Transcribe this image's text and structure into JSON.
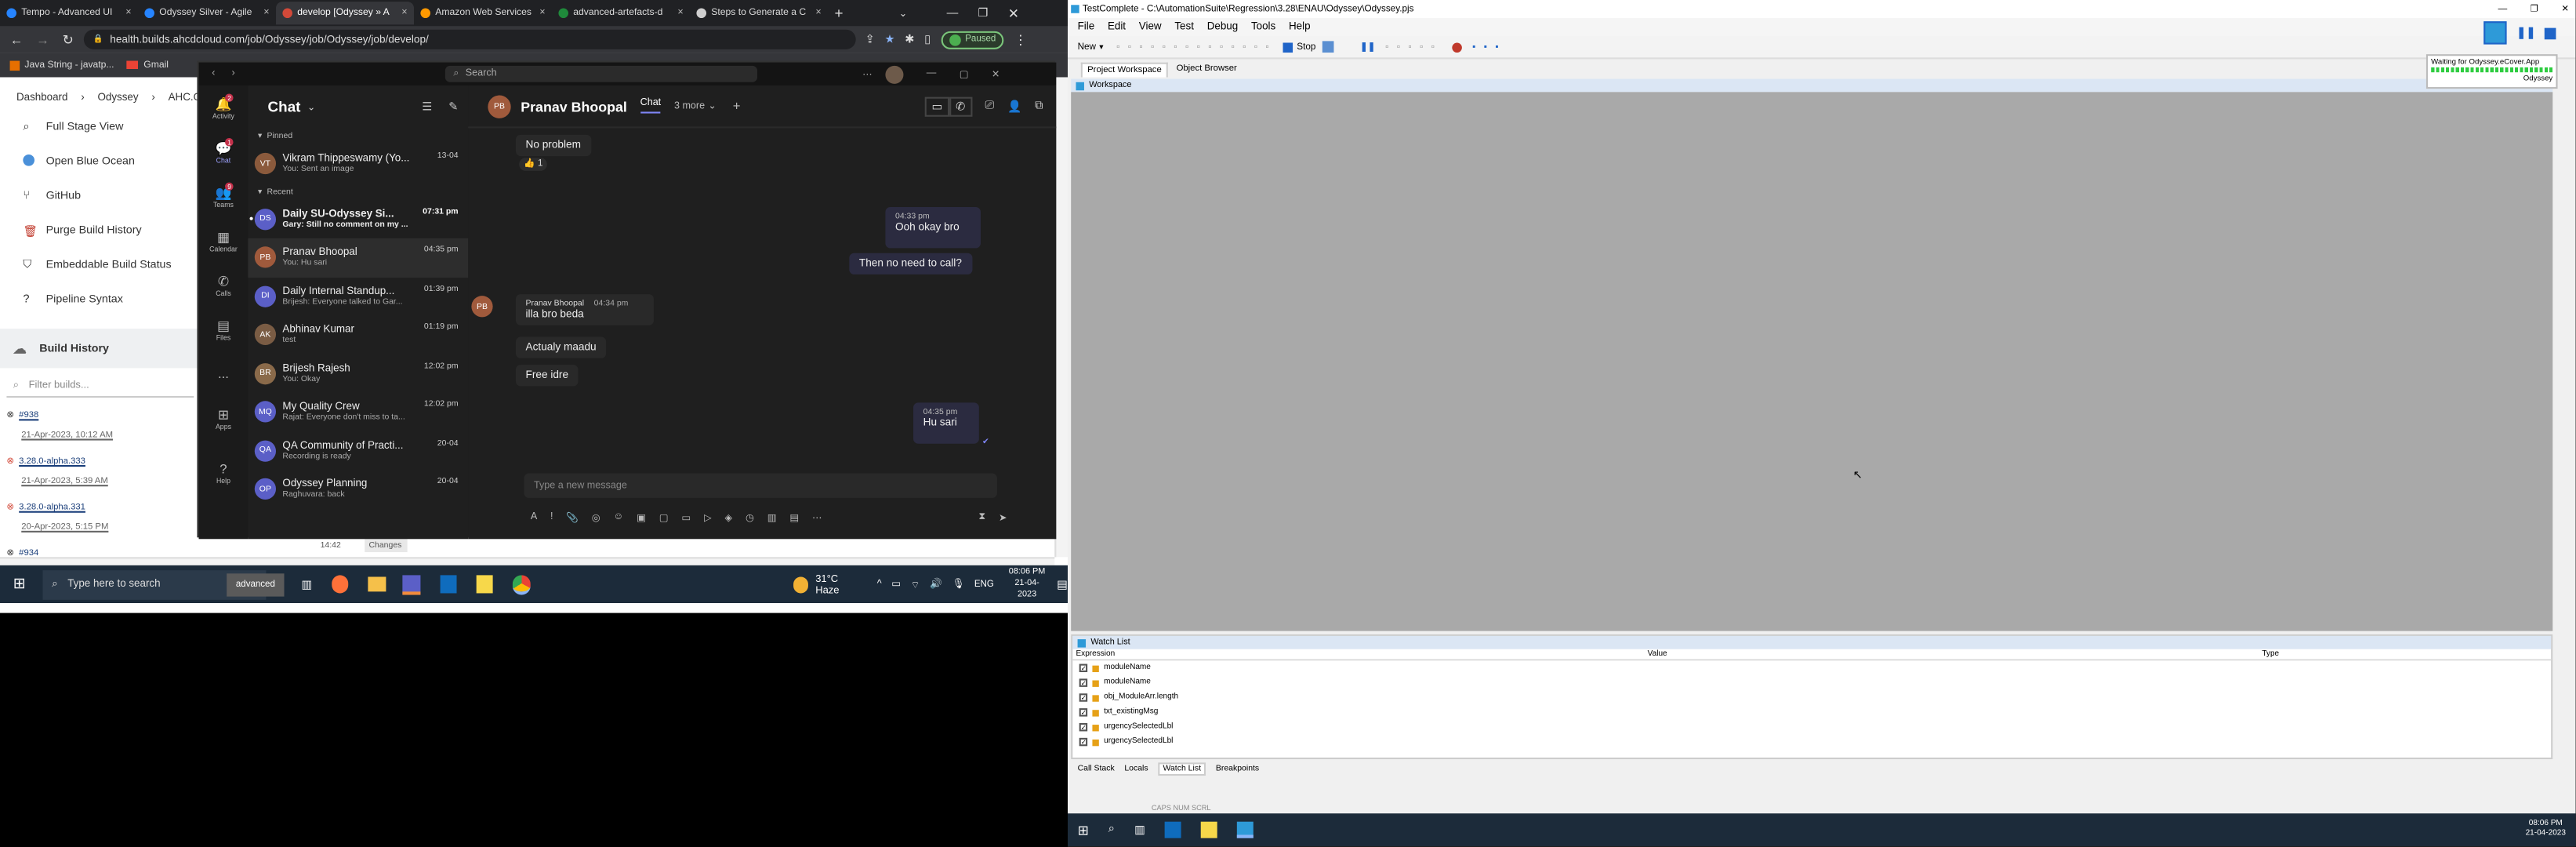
{
  "browser": {
    "tabs": [
      {
        "title": "Tempo - Advanced UI",
        "color": "#2684ff"
      },
      {
        "title": "Odyssey Silver - Agile",
        "color": "#2684ff"
      },
      {
        "title": "develop [Odyssey » A",
        "color": "#d24939"
      },
      {
        "title": "Amazon Web Services",
        "color": "#ff9900"
      },
      {
        "title": "advanced-artefacts-d",
        "color": "#1f8a3b"
      },
      {
        "title": "Steps to Generate a C",
        "color": "#cfcfcf"
      }
    ],
    "url": "health.builds.ahcdcloud.com/job/Odyssey/job/Odyssey/job/develop/",
    "profile_status": "Paused",
    "bookmarks": [
      "Java String - javatp...",
      "Gmail"
    ]
  },
  "jenkins": {
    "breadcrumbs": [
      "Dashboard",
      "Odyssey",
      "AHC.Od"
    ],
    "menu": [
      "Full Stage View",
      "Open Blue Ocean",
      "GitHub",
      "Purge Build History",
      "Embeddable Build Status",
      "Pipeline Syntax"
    ],
    "build_history_title": "Build History",
    "filter_placeholder": "Filter builds...",
    "builds": [
      {
        "name": "#938",
        "date": "21-Apr-2023, 10:12 AM"
      },
      {
        "name": "3.28.0-alpha.333",
        "date": "21-Apr-2023, 5:39 AM"
      },
      {
        "name": "3.28.0-alpha.331",
        "date": "20-Apr-2023, 5:15 PM"
      },
      {
        "name": "#934",
        "date": ""
      }
    ],
    "bottom_time": "14:42",
    "bottom_changes": "Changes"
  },
  "teams": {
    "search_placeholder": "Search",
    "rail": [
      {
        "label": "Activity",
        "badge": "2"
      },
      {
        "label": "Chat",
        "badge": "1"
      },
      {
        "label": "Teams",
        "badge": "9"
      },
      {
        "label": "Calendar",
        "badge": ""
      },
      {
        "label": "Calls",
        "badge": ""
      },
      {
        "label": "Files",
        "badge": ""
      },
      {
        "label": "...",
        "badge": ""
      },
      {
        "label": "Apps",
        "badge": ""
      },
      {
        "label": "Help",
        "badge": ""
      }
    ],
    "chat_title": "Chat",
    "pinned_label": "Pinned",
    "recent_label": "Recent",
    "pinned": [
      {
        "name": "Vikram Thippeswamy (Yo...",
        "preview": "You: Sent an image",
        "time": "13-04",
        "initials": "VT",
        "color": "#8b5a3c"
      }
    ],
    "recent": [
      {
        "name": "Daily SU-Odyssey Si...",
        "preview": "Gary: Still no comment on my ...",
        "time": "07:31 pm",
        "initials": "DS",
        "color": "#5b5fc7",
        "bold": true
      },
      {
        "name": "Pranav Bhoopal",
        "preview": "You: Hu sari",
        "time": "04:35 pm",
        "initials": "PB",
        "color": "#a05a3c",
        "bold": false
      },
      {
        "name": "Daily Internal Standup...",
        "preview": "Brijesh: Everyone talked to Gar...",
        "time": "01:39 pm",
        "initials": "DI",
        "color": "#5b5fc7",
        "bold": false
      },
      {
        "name": "Abhinav Kumar",
        "preview": "test",
        "time": "01:19 pm",
        "initials": "AK",
        "color": "#7a5c44",
        "bold": false
      },
      {
        "name": "Brijesh Rajesh",
        "preview": "You: Okay",
        "time": "12:02 pm",
        "initials": "BR",
        "color": "#8a6a4a",
        "bold": false
      },
      {
        "name": "My Quality Crew",
        "preview": "Rajat: Everyone don't miss to ta...",
        "time": "12:02 pm",
        "initials": "MQ",
        "color": "#5b5fc7",
        "bold": false
      },
      {
        "name": "QA Community of Practi...",
        "preview": "Recording is ready",
        "time": "20-04",
        "initials": "QA",
        "color": "#5b5fc7",
        "bold": false
      },
      {
        "name": "Odyssey Planning",
        "preview": "Raghuvara: back",
        "time": "20-04",
        "initials": "OP",
        "color": "#5b5fc7",
        "bold": false
      }
    ],
    "conversation": {
      "contact": "Pranav Bhoopal",
      "initials": "PB",
      "tab_chat": "Chat",
      "tab_more": "3 more",
      "messages": {
        "m1": "No problem",
        "m1_reaction": "👍 1",
        "m2_time": "04:33 pm",
        "m2": "Ooh okay bro",
        "m3": "Then no need to call?",
        "m4_sender": "Pranav Bhoopal",
        "m4_time": "04:34 pm",
        "m4": "illa bro beda",
        "m5": "Actualy maadu",
        "m6": "Free idre",
        "m7_time": "04:35 pm",
        "m7": "Hu sari"
      },
      "compose_placeholder": "Type a new message"
    }
  },
  "win_taskbar_left": {
    "search_placeholder": "Type here to search",
    "search_chip": "advanced",
    "weather": "31°C  Haze",
    "lang": "ENG",
    "time": "08:06 PM",
    "date": "21-04-2023"
  },
  "testcomplete": {
    "title": "TestComplete - C:\\AutomationSuite\\Regression\\3.28\\ENAU\\Odyssey\\Odyssey.pjs",
    "menu": [
      "File",
      "Edit",
      "View",
      "Test",
      "Debug",
      "Tools",
      "Help"
    ],
    "toolbar_new": "New",
    "toolbar_stop": "Stop",
    "tabs": [
      "Project Workspace",
      "Object Browser"
    ],
    "workspace_label": "Workspace",
    "waiting_text": "Waiting for Odyssey.eCover.App",
    "waiting_sub": "Odyssey",
    "watch_title": "Watch List",
    "watch_columns": [
      "Expression",
      "Value",
      "Type"
    ],
    "watch_rows": [
      "moduleName",
      "moduleName",
      "obj_ModuleArr.length",
      "txt_existingMsg",
      "urgencySelectedLbl",
      "urgencySelectedLbl"
    ],
    "bottom_tabs": [
      "Call Stack",
      "Locals",
      "Watch List",
      "Breakpoints"
    ],
    "status": "CAPS  NUM  SCRL",
    "taskbar_time": "08:06 PM",
    "taskbar_date": "21-04-2023"
  }
}
